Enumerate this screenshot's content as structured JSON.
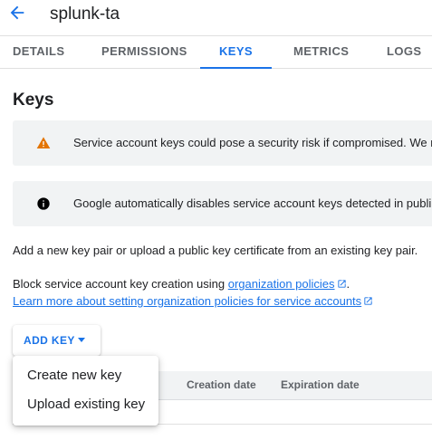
{
  "header": {
    "title": "splunk-ta",
    "back_icon": "arrow-back-icon"
  },
  "tabs": [
    {
      "label": "DETAILS"
    },
    {
      "label": "PERMISSIONS"
    },
    {
      "label": "KEYS",
      "active": true
    },
    {
      "label": "METRICS"
    },
    {
      "label": "LOGS"
    }
  ],
  "section": {
    "title": "Keys"
  },
  "banners": {
    "warning": {
      "icon": "warning-icon",
      "text": "Service account keys could pose a security risk if compromised. We r"
    },
    "info": {
      "icon": "info-icon",
      "text": "Google automatically disables service account keys detected in publi"
    }
  },
  "body": {
    "add_key_text": "Add a new key pair or upload a public key certificate from an existing key pair.",
    "block_text": "Block service account key creation using ",
    "policies_link": "organization policies",
    "period": ".",
    "learn_more_link": "Learn more about setting organization policies for service accounts"
  },
  "add_key_button": {
    "label": "ADD KEY"
  },
  "table": {
    "headers": [
      "Creation date",
      "Expiration date"
    ]
  },
  "menu": {
    "items": [
      "Create new key",
      "Upload existing key"
    ]
  },
  "colors": {
    "accent": "#1a73e8",
    "warning": "#e37400",
    "banner_bg": "#f1f3f4"
  }
}
